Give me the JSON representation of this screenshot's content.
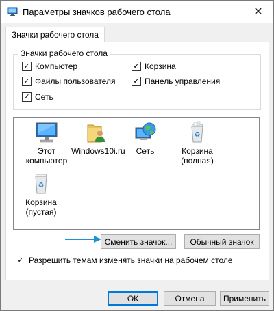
{
  "window": {
    "title": "Параметры значков рабочего стола"
  },
  "tab": {
    "label": "Значки рабочего стола"
  },
  "group": {
    "label": "Значки рабочего стола",
    "checkboxes": [
      {
        "label": "Компьютер",
        "checked": true
      },
      {
        "label": "Корзина",
        "checked": true
      },
      {
        "label": "Файлы пользователя",
        "checked": true
      },
      {
        "label": "Панель управления",
        "checked": true
      },
      {
        "label": "Сеть",
        "checked": true
      }
    ]
  },
  "icons": [
    {
      "label": "Этот компьютер",
      "icon": "computer-icon"
    },
    {
      "label": "Windows10i.ru",
      "icon": "user-folder-icon"
    },
    {
      "label": "Сеть",
      "icon": "network-globe-icon"
    },
    {
      "label": "Корзина (полная)",
      "icon": "recycle-bin-full-icon"
    },
    {
      "label": "Корзина (пустая)",
      "icon": "recycle-bin-empty-icon"
    }
  ],
  "buttons": {
    "change_icon": "Сменить значок...",
    "default_icon": "Обычный значок",
    "ok": "ОК",
    "cancel": "Отмена",
    "apply": "Применить"
  },
  "themes_checkbox": {
    "label": "Разрешить темам изменять значки на рабочем столе",
    "checked": true
  },
  "colors": {
    "accent": "#0078d7",
    "arrow": "#1e90d6"
  }
}
